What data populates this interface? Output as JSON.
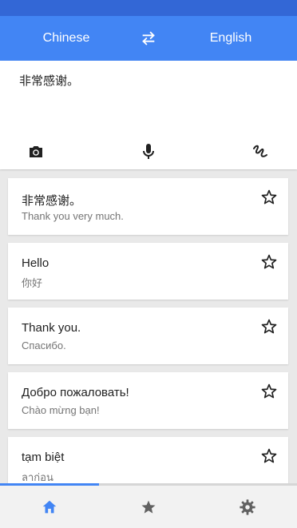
{
  "languages": {
    "source": "Chinese",
    "target": "English"
  },
  "input": {
    "text": "非常感谢。"
  },
  "tools": [
    "camera-icon",
    "microphone-icon",
    "handwriting-icon"
  ],
  "history": [
    {
      "source": "非常感谢。",
      "translation": "Thank you very much.",
      "starred": false
    },
    {
      "source": "Hello",
      "translation": "你好",
      "starred": false
    },
    {
      "source": "Thank you.",
      "translation": "Спасибо.",
      "starred": false
    },
    {
      "source": "Добро пожаловать!",
      "translation": "Chào mừng bạn!",
      "starred": false
    },
    {
      "source": "tạm biệt",
      "translation": "ลาก่อน",
      "starred": false
    }
  ],
  "nav": {
    "items": [
      "home-icon",
      "star-icon",
      "gear-icon"
    ],
    "active": "home-icon"
  },
  "colors": {
    "primary": "#4285f4",
    "status_bar": "#3367d6",
    "active_nav": "#4285f4",
    "inactive_nav": "#616161"
  }
}
